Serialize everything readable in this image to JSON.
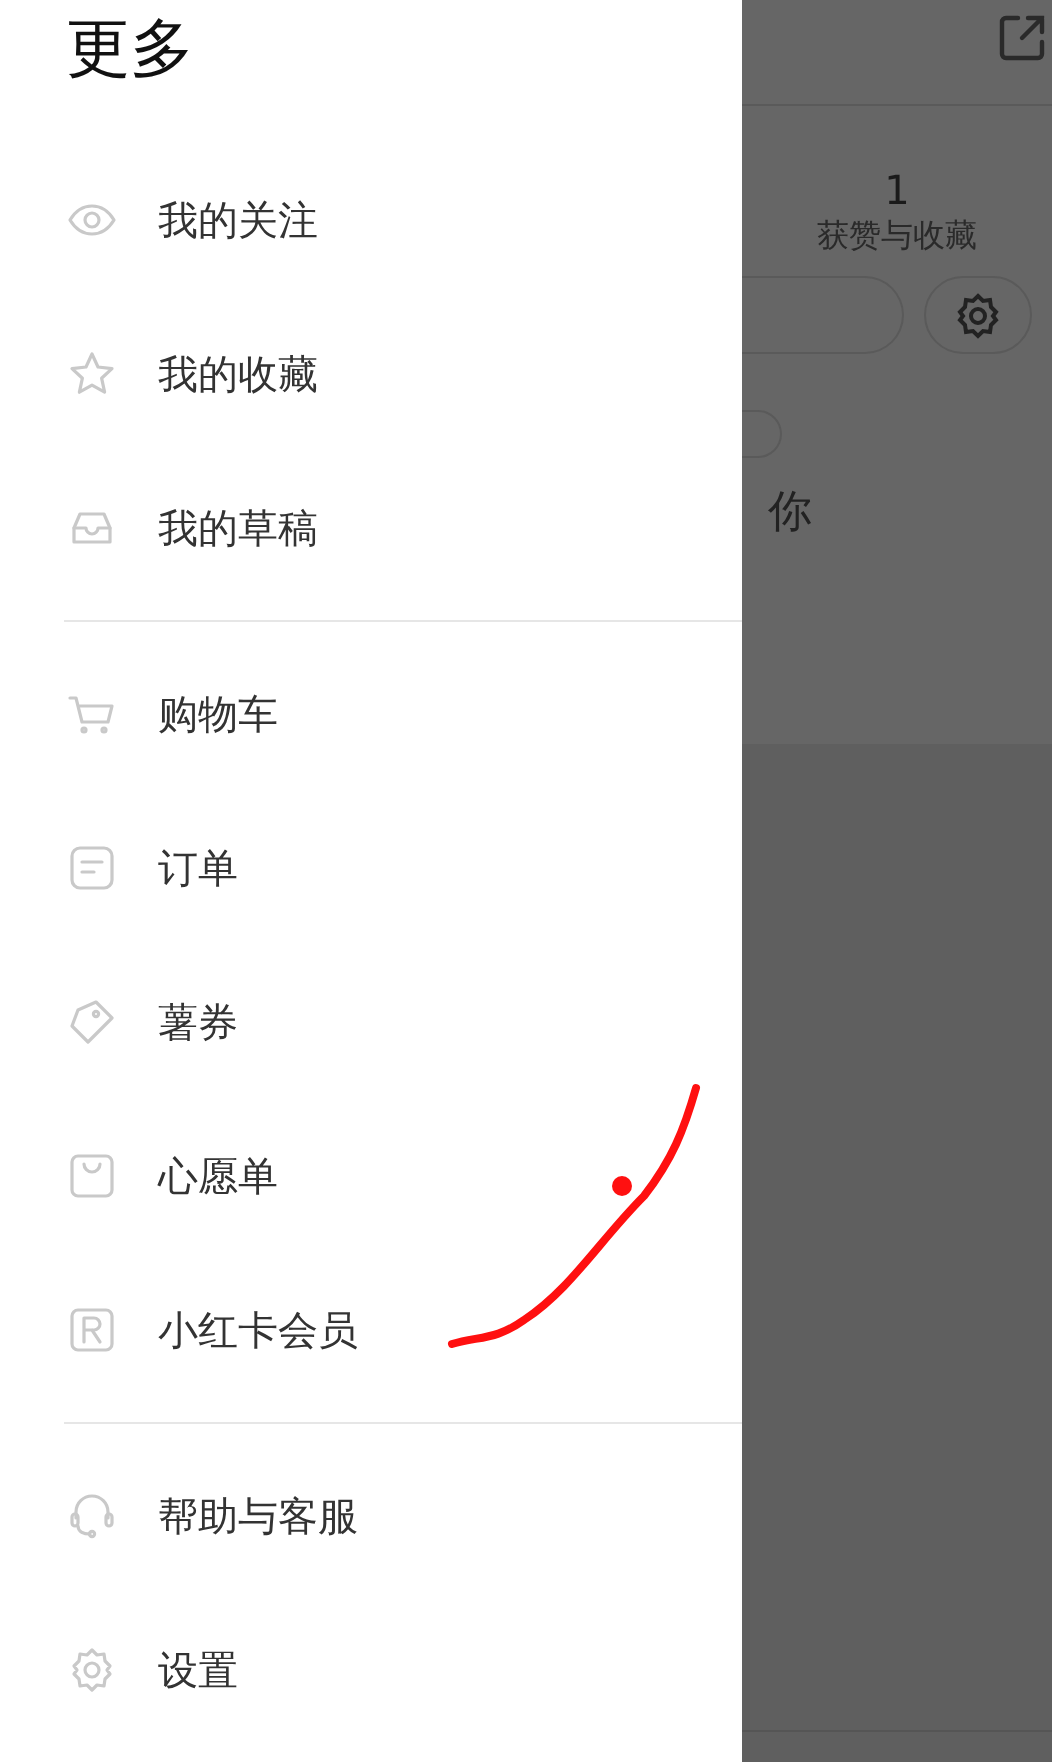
{
  "title": "更多",
  "menu_groups": [
    [
      {
        "label": "我的关注"
      },
      {
        "label": "我的收藏"
      },
      {
        "label": "我的草稿"
      }
    ],
    [
      {
        "label": "购物车"
      },
      {
        "label": "订单"
      },
      {
        "label": "薯券"
      },
      {
        "label": "心愿单"
      },
      {
        "label": "小红卡会员"
      }
    ],
    [
      {
        "label": "帮助与客服"
      },
      {
        "label": "设置"
      }
    ]
  ],
  "background": {
    "likes_count": "1",
    "likes_label": "获赞与收藏",
    "bio_fragment": "你"
  }
}
